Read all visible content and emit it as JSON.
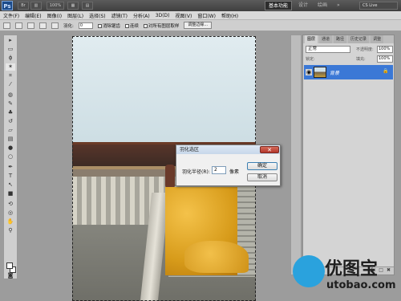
{
  "app": {
    "logo": "Ps",
    "zoom": "100%",
    "workspaces": [
      "基本功能",
      "设计",
      "绘画"
    ],
    "cslive": "CS Live"
  },
  "menu": [
    "文件(F)",
    "编辑(E)",
    "图像(I)",
    "图层(L)",
    "选择(S)",
    "滤镜(T)",
    "分析(A)",
    "3D(D)",
    "视图(V)",
    "窗口(W)",
    "帮助(H)"
  ],
  "options": {
    "feather_label": "羽化:",
    "feather_value": "0",
    "antialias": "消除锯齿",
    "contiguous": "连续",
    "sample_all": "对所有图层取样",
    "refine_edge": "调整边缘..."
  },
  "dialog": {
    "title": "羽化选区",
    "radius_label": "羽化半径(R):",
    "radius_value": "2",
    "unit": "像素",
    "ok": "确定",
    "cancel": "取消"
  },
  "layers": {
    "tabs": [
      "图层",
      "通道",
      "路径",
      "历史记录",
      "调整"
    ],
    "blend_mode": "正常",
    "opacity_label": "不透明度:",
    "opacity": "100%",
    "lock_label": "锁定:",
    "fill_label": "填充:",
    "fill": "100%",
    "layer_name": "背景"
  },
  "watermark": {
    "name": "优图宝",
    "url": "utobao.com"
  },
  "colors": {
    "selected_layer": "#3b78d6",
    "watermark_blue": "#2aa2dd"
  }
}
